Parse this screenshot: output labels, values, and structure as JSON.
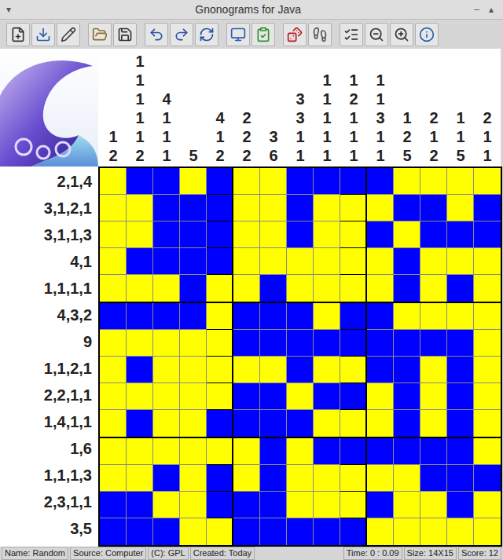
{
  "window": {
    "title": "Gnonograms for Java",
    "menu_glyph": "▾",
    "controls": [
      "–",
      "▴"
    ]
  },
  "column_clues": [
    [
      "1",
      "2"
    ],
    [
      "1",
      "1",
      "1",
      "1",
      "1",
      "2"
    ],
    [
      "4",
      "1",
      "1",
      "1"
    ],
    [
      "5"
    ],
    [
      "4",
      "1",
      "2"
    ],
    [
      "2",
      "2",
      "2"
    ],
    [
      "3",
      "6"
    ],
    [
      "3",
      "3",
      "1",
      "1"
    ],
    [
      "1",
      "1",
      "1",
      "1",
      "1"
    ],
    [
      "1",
      "2",
      "1",
      "1",
      "1"
    ],
    [
      "1",
      "1",
      "3",
      "1",
      "1"
    ],
    [
      "1",
      "2",
      "5"
    ],
    [
      "2",
      "1",
      "2"
    ],
    [
      "1",
      "1",
      "5"
    ],
    [
      "2",
      "1",
      "1"
    ]
  ],
  "rows": [
    {
      "clue": "2,1,4",
      "cells": [
        false,
        true,
        true,
        false,
        true,
        false,
        false,
        true,
        true,
        true,
        true,
        false,
        false,
        false,
        false
      ]
    },
    {
      "clue": "3,1,2,1",
      "cells": [
        false,
        false,
        true,
        true,
        true,
        false,
        false,
        true,
        false,
        false,
        false,
        true,
        true,
        false,
        true
      ]
    },
    {
      "clue": "3,1,1,3",
      "cells": [
        false,
        false,
        true,
        true,
        true,
        false,
        false,
        true,
        false,
        false,
        true,
        false,
        true,
        true,
        true
      ]
    },
    {
      "clue": "4,1",
      "cells": [
        false,
        true,
        true,
        true,
        true,
        false,
        false,
        false,
        false,
        false,
        false,
        true,
        false,
        false,
        false
      ]
    },
    {
      "clue": "1,1,1,1",
      "cells": [
        false,
        false,
        false,
        true,
        false,
        false,
        true,
        false,
        false,
        false,
        false,
        true,
        false,
        true,
        false
      ]
    },
    {
      "clue": "4,3,2",
      "cells": [
        true,
        true,
        true,
        true,
        false,
        true,
        true,
        true,
        false,
        true,
        true,
        false,
        false,
        false,
        false
      ]
    },
    {
      "clue": "9",
      "cells": [
        false,
        false,
        false,
        false,
        false,
        true,
        true,
        true,
        true,
        true,
        true,
        true,
        true,
        true,
        false
      ]
    },
    {
      "clue": "1,1,2,1",
      "cells": [
        false,
        true,
        false,
        false,
        false,
        false,
        false,
        true,
        false,
        false,
        true,
        true,
        false,
        true,
        false
      ]
    },
    {
      "clue": "2,2,1,1",
      "cells": [
        false,
        false,
        false,
        false,
        false,
        true,
        true,
        false,
        true,
        true,
        false,
        true,
        false,
        true,
        false
      ]
    },
    {
      "clue": "1,4,1,1",
      "cells": [
        false,
        true,
        false,
        false,
        true,
        true,
        true,
        true,
        false,
        false,
        false,
        true,
        false,
        true,
        false
      ]
    },
    {
      "clue": "1,6",
      "cells": [
        false,
        false,
        false,
        false,
        false,
        false,
        true,
        false,
        true,
        true,
        true,
        true,
        true,
        true,
        false
      ]
    },
    {
      "clue": "1,1,1,3",
      "cells": [
        false,
        false,
        true,
        false,
        true,
        false,
        true,
        false,
        false,
        false,
        false,
        false,
        true,
        true,
        true
      ]
    },
    {
      "clue": "2,3,1,1",
      "cells": [
        true,
        true,
        false,
        false,
        true,
        true,
        true,
        false,
        false,
        false,
        true,
        false,
        false,
        true,
        false
      ]
    },
    {
      "clue": "3,5",
      "cells": [
        true,
        true,
        true,
        false,
        false,
        true,
        true,
        true,
        true,
        true,
        false,
        false,
        false,
        false,
        false
      ]
    }
  ],
  "status_bar": {
    "left": [
      "Name: Random",
      "Source: Computer",
      "(C): GPL",
      "Created: Today"
    ],
    "right": [
      "Time: 0 : 0.09",
      "Size: 14X15",
      "Score: 12"
    ]
  }
}
